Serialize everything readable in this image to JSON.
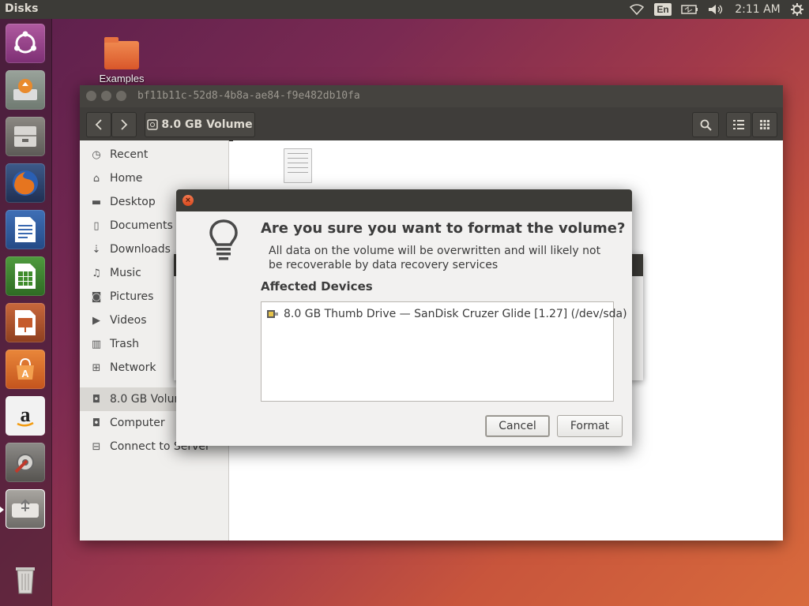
{
  "topbar": {
    "app_title": "Disks",
    "language": "En",
    "clock": "2:11 AM",
    "indicators": [
      "wifi-icon",
      "keyboard-language",
      "battery-icon",
      "volume-icon",
      "clock",
      "gear-icon"
    ]
  },
  "launcher": {
    "items": [
      "ubuntu-dash-icon",
      "software-updater-icon",
      "files-icon",
      "firefox-icon",
      "writer-icon",
      "calc-icon",
      "impress-icon",
      "software-center-icon",
      "amazon-icon",
      "system-settings-icon",
      "disks-icon",
      "trash-icon"
    ]
  },
  "desktop": {
    "icon_label": "Examples"
  },
  "file_manager": {
    "title": "bf11b11c-52d8-4b8a-ae84-f9e482db10fa",
    "path_label": "8.0 GB Volume",
    "sidebar": [
      {
        "label": "Recent",
        "icon": "clock-icon"
      },
      {
        "label": "Home",
        "icon": "home-icon"
      },
      {
        "label": "Desktop",
        "icon": "folder-icon"
      },
      {
        "label": "Documents",
        "icon": "document-icon"
      },
      {
        "label": "Downloads",
        "icon": "download-icon"
      },
      {
        "label": "Music",
        "icon": "music-icon"
      },
      {
        "label": "Pictures",
        "icon": "camera-icon"
      },
      {
        "label": "Videos",
        "icon": "video-icon"
      },
      {
        "label": "Trash",
        "icon": "trash-icon"
      },
      {
        "label": "Network",
        "icon": "network-icon"
      },
      {
        "label": "8.0 GB Volum",
        "icon": "drive-icon"
      },
      {
        "label": "Computer",
        "icon": "drive-icon"
      },
      {
        "label": "Connect to Server",
        "icon": "server-icon"
      }
    ]
  },
  "dialog": {
    "heading": "Are you sure you want to format the volume?",
    "body": "All data on the volume will be overwritten and will likely not be recoverable by data recovery services",
    "section_title": "Affected Devices",
    "device": "8.0 GB Thumb Drive — SanDisk Cruzer Glide [1.27] (/dev/sda)",
    "cancel_label": "Cancel",
    "format_label": "Format"
  },
  "colors": {
    "panel": "#3c3b37",
    "close_button": "#e25a2c",
    "dialog_bg": "#f2f1f0"
  }
}
